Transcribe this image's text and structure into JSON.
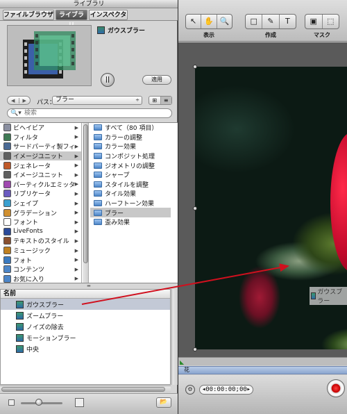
{
  "library": {
    "title": "ライブラリ",
    "tabs": [
      {
        "label": "ファイルブラウザ"
      },
      {
        "label": "ライブラリ"
      },
      {
        "label": "インスペクタ"
      }
    ],
    "preview": {
      "name": "ガウスブラー",
      "pause_label": "||",
      "apply_label": "適用"
    },
    "path": {
      "back_icon": "◀",
      "forward_icon": "▶",
      "label": "パス：",
      "value": "ブラー",
      "arrow": "÷",
      "grid_icon": "⊞",
      "list_icon": "≡"
    },
    "search": {
      "icon": "🔍▾",
      "placeholder": "検索"
    },
    "categories": [
      {
        "label": "ビヘイビア",
        "color": "#8a8fa0"
      },
      {
        "label": "フィルタ",
        "color": "#3f7a55"
      },
      {
        "label": "サードパーティ製フィ",
        "color": "#4a6a95"
      },
      {
        "label": "イメージユニット",
        "color": "#606060"
      },
      {
        "label": "ジェネレータ",
        "color": "#c05a2a"
      },
      {
        "label": "イメージユニット",
        "color": "#606060"
      },
      {
        "label": "パーティクルエミッタ",
        "color": "#a04ab0"
      },
      {
        "label": "リプリケータ",
        "color": "#6a5ac0"
      },
      {
        "label": "シェイプ",
        "color": "#3aa0d0"
      },
      {
        "label": "グラデーション",
        "color": "#d09030"
      },
      {
        "label": "フォント",
        "color": "#ffffff"
      },
      {
        "label": "LiveFonts",
        "color": "#2a4a9a"
      },
      {
        "label": "テキストのスタイル",
        "color": "#8a5030"
      },
      {
        "label": "ミュージック",
        "color": "#c08020"
      },
      {
        "label": "フォト",
        "color": "#3a7ac0"
      },
      {
        "label": "コンテンツ",
        "color": "#4d86c8"
      },
      {
        "label": "お気に入り",
        "color": "#4d86c8"
      }
    ],
    "category_chevron": "▶",
    "blur_items": [
      {
        "label": "すべて（80 項目）"
      },
      {
        "label": "カラーの調整"
      },
      {
        "label": "カラー効果"
      },
      {
        "label": "コンポジット処理"
      },
      {
        "label": "ジオメトリの調整"
      },
      {
        "label": "シャープ"
      },
      {
        "label": "スタイルを調整"
      },
      {
        "label": "タイル効果"
      },
      {
        "label": "ハーフトーン効果"
      },
      {
        "label": "ブラー"
      },
      {
        "label": "歪み効果"
      }
    ],
    "splitter_grip": "▬",
    "list": {
      "header": "名前",
      "items": [
        {
          "label": "ガウスブラー"
        },
        {
          "label": "ズームブラー"
        },
        {
          "label": "ノイズの除去"
        },
        {
          "label": "モーションブラー"
        },
        {
          "label": "中央"
        }
      ]
    },
    "bottom": {
      "folder_button": "📂"
    }
  },
  "canvas": {
    "tools": {
      "view": {
        "label": "表示",
        "icons": [
          "↖",
          "✋",
          "🔍"
        ]
      },
      "create": {
        "label": "作成",
        "icons": [
          "□",
          "✎",
          "T"
        ]
      },
      "mask": {
        "label": "マスク",
        "icons": [
          "▣",
          "⬚"
        ]
      }
    },
    "drag_label": "ガウスブラー",
    "timeline": {
      "marker": "◣",
      "layer_name": "花",
      "gear_icon": "⚙",
      "timecode": "00:00:00;00",
      "timecode_left": "◀",
      "timecode_right": "▶"
    }
  },
  "colors": {
    "arrow": "#d0101e",
    "selection": "#c8c8c8",
    "list_selection": "#c3c9d6"
  }
}
